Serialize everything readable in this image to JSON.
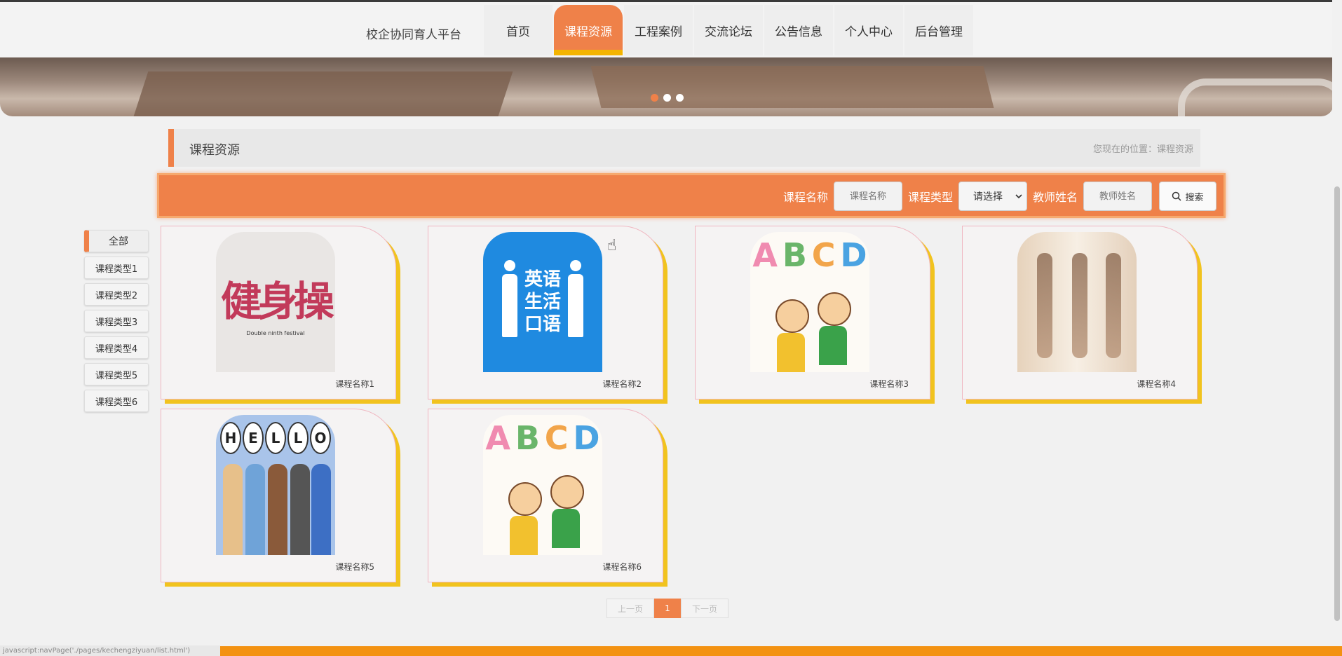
{
  "header": {
    "brand": "校企协同育人平台",
    "nav": [
      "首页",
      "课程资源",
      "工程案例",
      "交流论坛",
      "公告信息",
      "个人中心",
      "后台管理"
    ],
    "active_index": 1
  },
  "banner": {
    "dots": 3,
    "active_dot": 0
  },
  "breadcrumb": {
    "title": "课程资源",
    "location": "您现在的位置：课程资源"
  },
  "search": {
    "name_label": "课程名称",
    "name_placeholder": "课程名称",
    "type_label": "课程类型",
    "type_value": "请选择",
    "teacher_label": "教师姓名",
    "teacher_placeholder": "教师姓名",
    "button_label": "搜索"
  },
  "sidebar": {
    "items": [
      "全部",
      "课程类型1",
      "课程类型2",
      "课程类型3",
      "课程类型4",
      "课程类型5",
      "课程类型6"
    ],
    "active_index": 0
  },
  "cards": [
    {
      "title": "课程名称1",
      "image_text": "健身操",
      "image_subtext": "Double ninth festival"
    },
    {
      "title": "课程名称2",
      "image_text": "英语生活口语"
    },
    {
      "title": "课程名称3",
      "image_text": "ABCD"
    },
    {
      "title": "课程名称4"
    },
    {
      "title": "课程名称5",
      "image_text": "HELLO"
    },
    {
      "title": "课程名称6",
      "image_text": "ABCD"
    }
  ],
  "pager": {
    "prev": "上一页",
    "current": "1",
    "next": "下一页"
  },
  "status_bar": {
    "url": "javascript:navPage('./pages/kechengziyuan/list.html')"
  },
  "colors": {
    "accent": "#ef8149",
    "card_shadow": "#f1c31e",
    "bottom_strip": "#f39212"
  }
}
